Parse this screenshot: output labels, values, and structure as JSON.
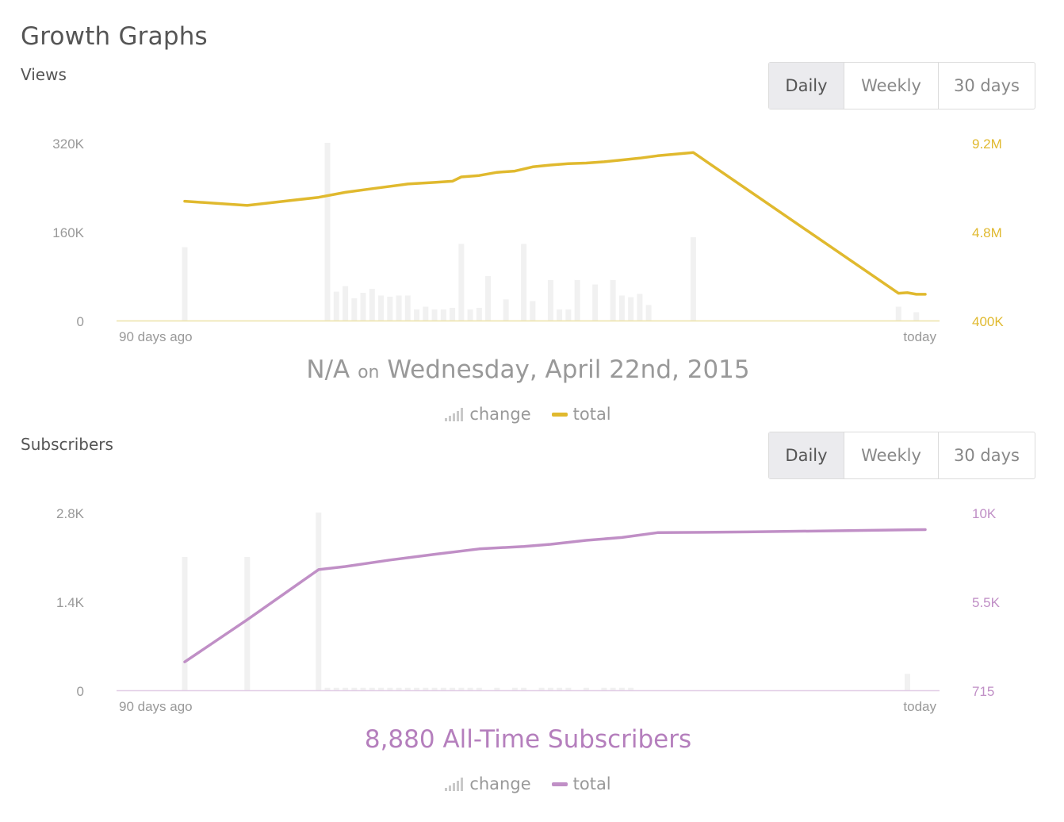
{
  "page": {
    "title": "Growth Graphs"
  },
  "colors": {
    "views": "#e0b92e",
    "subscribers": "#c08fc6",
    "bar": "#f1f1f1",
    "axis": "#9a9a9a"
  },
  "views": {
    "title": "Views",
    "tabs": [
      {
        "label": "Daily",
        "active": true
      },
      {
        "label": "Weekly",
        "active": false
      },
      {
        "label": "30 days",
        "active": false
      }
    ],
    "summary": {
      "value": "N/A",
      "on": "on",
      "date": "Wednesday, April 22nd, 2015"
    },
    "legend": {
      "change_icon": "bars-icon",
      "change": "change",
      "total": "total"
    }
  },
  "subscribers": {
    "title": "Subscribers",
    "tabs": [
      {
        "label": "Daily",
        "active": true
      },
      {
        "label": "Weekly",
        "active": false
      },
      {
        "label": "30 days",
        "active": false
      }
    ],
    "summary": "8,880 All-Time Subscribers",
    "legend": {
      "change_icon": "bars-icon",
      "change": "change",
      "total": "total"
    }
  },
  "chart_data": [
    {
      "type": "bar+line",
      "name": "views",
      "x_range": [
        -90,
        0
      ],
      "x_tick_labels": [
        "90 days ago",
        "today"
      ],
      "left_axis": {
        "ticks": [
          "0",
          "160K",
          "320K"
        ],
        "range": [
          0,
          320000
        ]
      },
      "right_axis": {
        "ticks": [
          "400K",
          "4.8M",
          "9.2M"
        ],
        "range": [
          400000,
          9200000
        ]
      },
      "series": [
        {
          "name": "change",
          "kind": "bar",
          "axis": "left",
          "points": [
            [
              -83,
              132000
            ],
            [
              -67,
              320000
            ],
            [
              -66,
              52000
            ],
            [
              -65,
              62000
            ],
            [
              -64,
              40000
            ],
            [
              -63,
              50000
            ],
            [
              -62,
              57000
            ],
            [
              -61,
              45000
            ],
            [
              -60,
              43000
            ],
            [
              -59,
              45000
            ],
            [
              -58,
              45000
            ],
            [
              -57,
              20000
            ],
            [
              -56,
              25000
            ],
            [
              -55,
              20000
            ],
            [
              -54,
              20000
            ],
            [
              -53,
              23000
            ],
            [
              -52,
              138000
            ],
            [
              -51,
              20000
            ],
            [
              -50,
              23000
            ],
            [
              -49,
              80000
            ],
            [
              -47,
              38000
            ],
            [
              -45,
              138000
            ],
            [
              -44,
              35000
            ],
            [
              -42,
              73000
            ],
            [
              -41,
              20000
            ],
            [
              -40,
              20000
            ],
            [
              -39,
              73000
            ],
            [
              -37,
              65000
            ],
            [
              -35,
              73000
            ],
            [
              -34,
              45000
            ],
            [
              -33,
              42000
            ],
            [
              -32,
              48000
            ],
            [
              -31,
              28000
            ],
            [
              -26,
              150000
            ],
            [
              -3,
              25000
            ],
            [
              -1,
              15000
            ]
          ]
        },
        {
          "name": "total",
          "kind": "line",
          "axis": "right",
          "points": [
            [
              -83,
              6310000
            ],
            [
              -76,
              6100000
            ],
            [
              -68,
              6500000
            ],
            [
              -65,
              6750000
            ],
            [
              -62,
              6930000
            ],
            [
              -58,
              7160000
            ],
            [
              -55,
              7240000
            ],
            [
              -53,
              7300000
            ],
            [
              -52,
              7510000
            ],
            [
              -50,
              7580000
            ],
            [
              -48,
              7740000
            ],
            [
              -46,
              7800000
            ],
            [
              -44,
              8010000
            ],
            [
              -42,
              8100000
            ],
            [
              -40,
              8170000
            ],
            [
              -38,
              8200000
            ],
            [
              -36,
              8260000
            ],
            [
              -34,
              8350000
            ],
            [
              -32,
              8440000
            ],
            [
              -30,
              8560000
            ],
            [
              -26,
              8720000
            ],
            [
              -3,
              1750000
            ],
            [
              -2,
              1780000
            ],
            [
              -1,
              1700000
            ],
            [
              0,
              1700000
            ]
          ]
        }
      ]
    },
    {
      "type": "bar+line",
      "name": "subscribers",
      "x_range": [
        -90,
        0
      ],
      "x_tick_labels": [
        "90 days ago",
        "today"
      ],
      "left_axis": {
        "ticks": [
          "0",
          "1.4K",
          "2.8K"
        ],
        "range": [
          0,
          2800
        ]
      },
      "right_axis": {
        "ticks": [
          "715",
          "5.5K",
          "10K"
        ],
        "range": [
          715,
          10000
        ]
      },
      "series": [
        {
          "name": "change",
          "kind": "bar",
          "axis": "left",
          "points": [
            [
              -83,
              2100
            ],
            [
              -76,
              2100
            ],
            [
              -68,
              2800
            ],
            [
              -67,
              40
            ],
            [
              -66,
              40
            ],
            [
              -65,
              40
            ],
            [
              -64,
              40
            ],
            [
              -63,
              40
            ],
            [
              -62,
              40
            ],
            [
              -61,
              40
            ],
            [
              -60,
              40
            ],
            [
              -59,
              40
            ],
            [
              -58,
              40
            ],
            [
              -57,
              40
            ],
            [
              -56,
              40
            ],
            [
              -55,
              40
            ],
            [
              -54,
              40
            ],
            [
              -53,
              40
            ],
            [
              -52,
              40
            ],
            [
              -51,
              40
            ],
            [
              -50,
              40
            ],
            [
              -48,
              40
            ],
            [
              -46,
              40
            ],
            [
              -45,
              40
            ],
            [
              -43,
              40
            ],
            [
              -42,
              40
            ],
            [
              -41,
              40
            ],
            [
              -40,
              40
            ],
            [
              -38,
              40
            ],
            [
              -36,
              40
            ],
            [
              -35,
              40
            ],
            [
              -34,
              40
            ],
            [
              -33,
              40
            ],
            [
              -2,
              260
            ]
          ]
        },
        {
          "name": "total",
          "kind": "line",
          "axis": "right",
          "points": [
            [
              -83,
              2200
            ],
            [
              -76,
              4400
            ],
            [
              -68,
              7020
            ],
            [
              -65,
              7180
            ],
            [
              -60,
              7520
            ],
            [
              -55,
              7820
            ],
            [
              -50,
              8100
            ],
            [
              -45,
              8230
            ],
            [
              -42,
              8340
            ],
            [
              -38,
              8550
            ],
            [
              -34,
              8700
            ],
            [
              -30,
              8950
            ],
            [
              -20,
              8990
            ],
            [
              0,
              9110
            ]
          ]
        }
      ]
    }
  ]
}
